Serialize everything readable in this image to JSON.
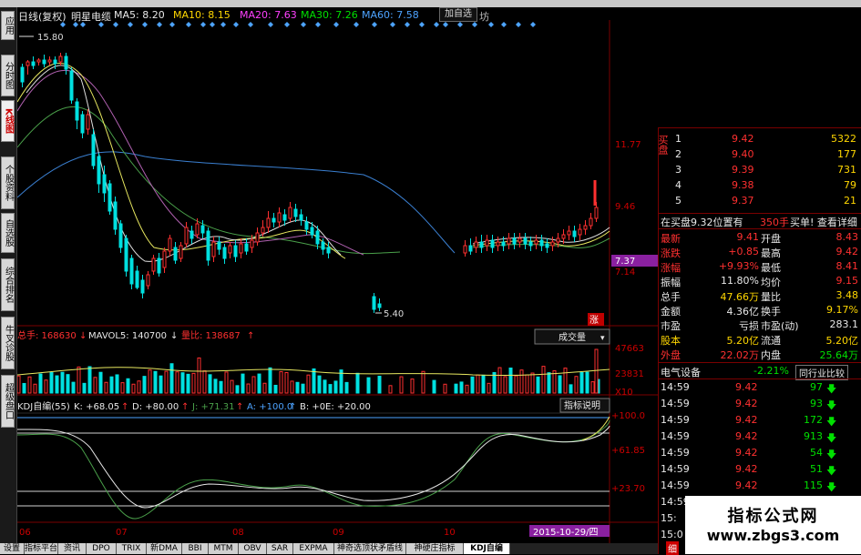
{
  "top_menu": "",
  "left_tabs": [
    "应用",
    "分时图",
    "K线图",
    "个股资料",
    "自选股",
    "综合排名",
    "牛叉诊股",
    "超级盘口"
  ],
  "header": {
    "period": "日线(复权)",
    "stock_name": "明星电缆",
    "ma5": "MA5: 8.20",
    "ma10": "MA10: 8.15",
    "ma20": "MA20: 7.63",
    "ma30": "MA30: 7.26",
    "ma60": "MA60: 7.58",
    "add_fav": "加自选",
    "extra": "坊"
  },
  "price_axis": {
    "labels": [
      "11.77",
      "9.46",
      "7.37",
      "7.14"
    ],
    "high_marker": "15.80",
    "low_marker": "5.40",
    "zhang_badge": "涨"
  },
  "volume": {
    "total_label": "总手: 168630",
    "mavol_label": "MAVOL5: 140700",
    "ratio_label": "量比: 138687",
    "select_label": "成交量",
    "axis_labels": [
      "47663",
      "23831",
      "X10"
    ]
  },
  "kdj": {
    "title": "KDJ自编(55)",
    "k": "K: +68.05",
    "d": "D: +80.00",
    "j": "J: +71.31",
    "a": "A: +100.0",
    "b": "B: +0",
    "e": "E: +20.00",
    "help_button": "指标说明",
    "axis_labels": [
      "+100.0",
      "+61.85",
      "+23.70"
    ]
  },
  "date_axis": {
    "labels": [
      "06",
      "07",
      "08",
      "09",
      "10"
    ],
    "current_date": "2015-10-29/四"
  },
  "order_book": {
    "side_label_buy": "买盘",
    "rows": [
      {
        "level": "1",
        "price": "9.42",
        "vol": "5322"
      },
      {
        "level": "2",
        "price": "9.40",
        "vol": "177"
      },
      {
        "level": "3",
        "price": "9.39",
        "vol": "731"
      },
      {
        "level": "4",
        "price": "9.38",
        "vol": "79"
      },
      {
        "level": "5",
        "price": "9.37",
        "vol": "21"
      }
    ],
    "summary": "在买盘9.32位置有",
    "summary_vol": "350手",
    "summary_action": "买单! 查看详细"
  },
  "quote": {
    "rows": [
      {
        "l1": "最新",
        "v1": "9.41",
        "l2": "开盘",
        "v2": "8.43"
      },
      {
        "l1": "涨跌",
        "v1": "+0.85",
        "l2": "最高",
        "v2": "9.42"
      },
      {
        "l1": "涨幅",
        "v1": "+9.93%",
        "l2": "最低",
        "v2": "8.41"
      },
      {
        "l1": "振幅",
        "v1": "11.80%",
        "l2": "均价",
        "v2": "9.15"
      },
      {
        "l1": "总手",
        "v1": "47.66万",
        "l2": "量比",
        "v2": "3.48"
      },
      {
        "l1": "金额",
        "v1": "4.36亿",
        "l2": "换手",
        "v2": "9.17%"
      },
      {
        "l1": "市盈",
        "v1": "亏损",
        "l2": "市盈(动)",
        "v2": "283.1"
      },
      {
        "l1": "股本",
        "v1": "5.20亿",
        "l2": "流通",
        "v2": "5.20亿"
      },
      {
        "l1": "外盘",
        "v1": "22.02万",
        "l2": "内盘",
        "v2": "25.64万"
      }
    ]
  },
  "industry": {
    "name": "电气设备",
    "change": "-2.21%",
    "compare_button": "同行业比较"
  },
  "ticks": [
    {
      "time": "14:59",
      "price": "9.42",
      "vol": "97"
    },
    {
      "time": "14:59",
      "price": "9.42",
      "vol": "93"
    },
    {
      "time": "14:59",
      "price": "9.42",
      "vol": "172"
    },
    {
      "time": "14:59",
      "price": "9.42",
      "vol": "913"
    },
    {
      "time": "14:59",
      "price": "9.42",
      "vol": "54"
    },
    {
      "time": "14:59",
      "price": "9.42",
      "vol": "51"
    },
    {
      "time": "14:59",
      "price": "9.42",
      "vol": "115"
    },
    {
      "time": "14:59",
      "price": "",
      "vol": ""
    },
    {
      "time": "15:",
      "price": "",
      "vol": ""
    },
    {
      "time": "15:0",
      "price": "",
      "vol": ""
    }
  ],
  "bottom_tabs": [
    "设置",
    "指标平台",
    "资讯",
    "DPO",
    "TRIX",
    "新DMA",
    "BBI",
    "MTM",
    "OBV",
    "SAR",
    "EXPMA",
    "神奇选顶状矛盾线",
    "神硬庄指标",
    "KDJ自编"
  ],
  "right_bottom_label": "细",
  "watermark": {
    "line1": "指标公式网",
    "line2": "www.zbgs3.com"
  },
  "colors": {
    "up": "#ff3030",
    "down": "#00e0e0",
    "bg": "#000000",
    "frame": "#7a0000"
  }
}
